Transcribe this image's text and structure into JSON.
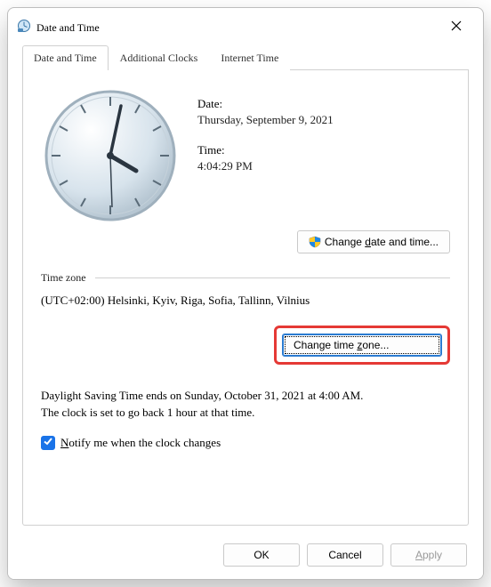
{
  "window": {
    "title": "Date and Time"
  },
  "tabs": {
    "items": [
      {
        "label": "Date and Time",
        "active": true
      },
      {
        "label": "Additional Clocks",
        "active": false
      },
      {
        "label": "Internet Time",
        "active": false
      }
    ]
  },
  "datetime": {
    "date_label": "Date:",
    "date_value": "Thursday, September 9, 2021",
    "time_label": "Time:",
    "time_value": "4:04:29 PM"
  },
  "buttons": {
    "change_date_time_prefix": "Change ",
    "change_date_time_hot": "d",
    "change_date_time_suffix": "ate and time...",
    "change_time_zone_prefix": "Change time ",
    "change_time_zone_hot": "z",
    "change_time_zone_suffix": "one..."
  },
  "timezone": {
    "group_label": "Time zone",
    "current": "(UTC+02:00) Helsinki, Kyiv, Riga, Sofia, Tallinn, Vilnius"
  },
  "dst": {
    "line1": "Daylight Saving Time ends on Sunday, October 31, 2021 at 4:00 AM.",
    "line2": "The clock is set to go back 1 hour at that time."
  },
  "notify": {
    "checked": true,
    "label_hot": "N",
    "label_rest": "otify me when the clock changes"
  },
  "bottom": {
    "ok": "OK",
    "cancel": "Cancel",
    "apply_hot": "A",
    "apply_rest": "pply"
  }
}
